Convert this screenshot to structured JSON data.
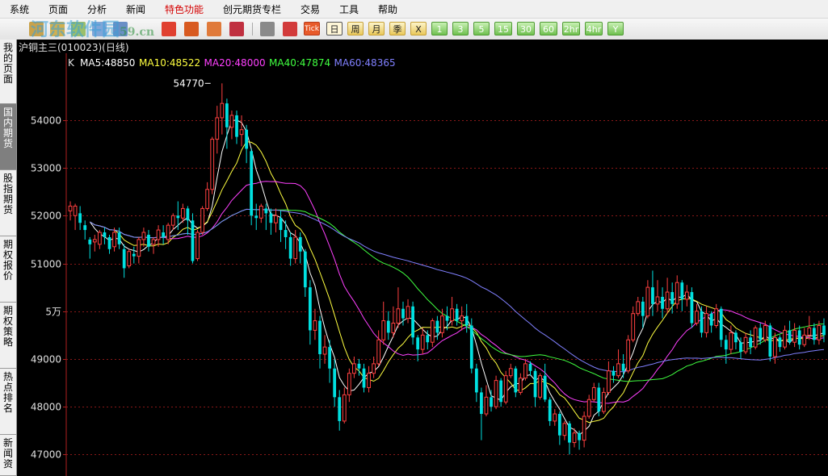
{
  "menu": {
    "items": [
      "系统",
      "页面",
      "分析",
      "新闻",
      "特色功能",
      "创元期货专栏",
      "交易",
      "工具",
      "帮助"
    ],
    "highlight_color": "#d40000"
  },
  "toolbar": {
    "period_buttons": [
      "日",
      "周",
      "月",
      "季",
      "X",
      "1",
      "3",
      "5",
      "15",
      "30",
      "60",
      "2hr",
      "4hr",
      "Y"
    ],
    "tick_label": "Tick",
    "active": "日"
  },
  "watermark": {
    "text": "河东软件园",
    "suffix": "59.cn"
  },
  "sidebar": {
    "tabs": [
      "我的页面",
      "国内期货",
      "股指期货",
      "期权报价",
      "期权策略",
      "热点排名",
      "新闻资"
    ],
    "active": "国内期货"
  },
  "title": "沪铜主三(010023)(日线)",
  "indicators": {
    "k_label": "K",
    "items": [
      {
        "label": "MA5:48850",
        "color": "#ffffff"
      },
      {
        "label": "MA10:48522",
        "color": "#ffff40"
      },
      {
        "label": "MA20:48000",
        "color": "#ff40ff"
      },
      {
        "label": "MA40:47874",
        "color": "#40ff40"
      },
      {
        "label": "MA60:48365",
        "color": "#8080ff"
      }
    ]
  },
  "chart_data": {
    "type": "candlestick",
    "y_ticks": [
      {
        "value": 54000,
        "label": "54000"
      },
      {
        "value": 53000,
        "label": "53000"
      },
      {
        "value": 52000,
        "label": "52000"
      },
      {
        "value": 51000,
        "label": "51000"
      },
      {
        "value": 50000,
        "label": "5万"
      },
      {
        "value": 49000,
        "label": "49000"
      },
      {
        "value": 48000,
        "label": "48000"
      },
      {
        "value": 47000,
        "label": "47000"
      }
    ],
    "ylim": [
      46550,
      55400
    ],
    "grid": "horizontal dashed",
    "max_annotation": {
      "label": "54770",
      "value": 54770,
      "index": 29
    },
    "up_color": "#ff4040",
    "down_color": "#00e0e0",
    "candles": [
      [
        52100,
        52200,
        51900,
        52300
      ],
      [
        52000,
        52200,
        51700,
        52250
      ],
      [
        52050,
        51850,
        51700,
        52200
      ],
      [
        51800,
        51700,
        51500,
        51900
      ],
      [
        51500,
        51400,
        51100,
        51550
      ],
      [
        51450,
        51500,
        51250,
        51600
      ],
      [
        51400,
        51650,
        51300,
        51700
      ],
      [
        51650,
        51550,
        51400,
        51750
      ],
      [
        51550,
        51300,
        51200,
        51600
      ],
      [
        51350,
        51650,
        51250,
        51750
      ],
      [
        51650,
        51400,
        51300,
        51750
      ],
      [
        51300,
        50900,
        50700,
        51400
      ],
      [
        50950,
        51250,
        50900,
        51300
      ],
      [
        51200,
        51150,
        51000,
        51350
      ],
      [
        51150,
        51500,
        51000,
        51550
      ],
      [
        51500,
        51650,
        51350,
        51750
      ],
      [
        51600,
        51350,
        51250,
        51700
      ],
      [
        51400,
        51500,
        51200,
        51550
      ],
      [
        51500,
        51700,
        51350,
        51800
      ],
      [
        51650,
        51550,
        51400,
        51800
      ],
      [
        51500,
        51800,
        51400,
        51850
      ],
      [
        51800,
        52000,
        51700,
        52050
      ],
      [
        52000,
        51950,
        51700,
        52300
      ],
      [
        51950,
        52150,
        51850,
        52250
      ],
      [
        52150,
        51900,
        51600,
        52200
      ],
      [
        51900,
        51050,
        51000,
        52050
      ],
      [
        51100,
        51650,
        51050,
        51700
      ],
      [
        51650,
        52150,
        51600,
        52200
      ],
      [
        52150,
        52550,
        52100,
        52700
      ],
      [
        52550,
        53600,
        52450,
        53650
      ],
      [
        53600,
        54050,
        53300,
        54300
      ],
      [
        54050,
        54350,
        53700,
        54770
      ],
      [
        54350,
        53850,
        53400,
        54450
      ],
      [
        53850,
        54100,
        53600,
        54200
      ],
      [
        54100,
        53650,
        53500,
        54200
      ],
      [
        53700,
        53800,
        53450,
        54100
      ],
      [
        53800,
        53400,
        53100,
        53900
      ],
      [
        53350,
        52000,
        51800,
        53400
      ],
      [
        52000,
        51950,
        51700,
        52250
      ],
      [
        51950,
        52200,
        51850,
        52250
      ],
      [
        52150,
        52050,
        51700,
        52250
      ],
      [
        52050,
        51850,
        51600,
        52150
      ],
      [
        51850,
        52000,
        51650,
        52150
      ],
      [
        51950,
        51700,
        51450,
        52100
      ],
      [
        51700,
        51550,
        51300,
        51900
      ],
      [
        51550,
        51100,
        50950,
        51650
      ],
      [
        51100,
        51550,
        51000,
        51700
      ],
      [
        51550,
        51250,
        51000,
        51650
      ],
      [
        51250,
        50500,
        50300,
        51300
      ],
      [
        50500,
        49600,
        49300,
        50650
      ],
      [
        49600,
        49800,
        49400,
        50050
      ],
      [
        49800,
        49100,
        48800,
        49900
      ],
      [
        49100,
        49250,
        48900,
        49500
      ],
      [
        49250,
        48800,
        48500,
        49400
      ],
      [
        48800,
        48200,
        48000,
        49000
      ],
      [
        48200,
        47700,
        47500,
        48350
      ],
      [
        47700,
        48250,
        47650,
        48400
      ],
      [
        48250,
        48700,
        48100,
        48800
      ],
      [
        48700,
        48900,
        48600,
        49050
      ],
      [
        48900,
        48800,
        48650,
        49000
      ],
      [
        48800,
        48400,
        48300,
        48900
      ],
      [
        48400,
        48700,
        48300,
        48850
      ],
      [
        48700,
        48900,
        48600,
        49050
      ],
      [
        48900,
        49400,
        48850,
        49600
      ],
      [
        49400,
        49800,
        49300,
        50200
      ],
      [
        49800,
        49550,
        49400,
        50000
      ],
      [
        49550,
        49750,
        49450,
        50100
      ],
      [
        49750,
        50050,
        49650,
        50500
      ],
      [
        50050,
        49850,
        49700,
        50200
      ],
      [
        49850,
        50100,
        49750,
        50250
      ],
      [
        50100,
        49450,
        49300,
        50200
      ],
      [
        49450,
        49200,
        48950,
        49500
      ],
      [
        49200,
        49500,
        49100,
        49650
      ],
      [
        49500,
        49350,
        49200,
        49600
      ],
      [
        49350,
        49800,
        49250,
        49850
      ],
      [
        49800,
        49550,
        49400,
        49900
      ],
      [
        49550,
        49900,
        49450,
        50050
      ],
      [
        49900,
        49800,
        49600,
        50100
      ],
      [
        49800,
        50050,
        49700,
        50300
      ],
      [
        50050,
        49800,
        49700,
        50150
      ],
      [
        49800,
        49900,
        49600,
        50100
      ],
      [
        49900,
        49700,
        49550,
        50150
      ],
      [
        49700,
        48800,
        48700,
        49850
      ],
      [
        48800,
        48300,
        48100,
        48900
      ],
      [
        48300,
        47850,
        47300,
        48400
      ],
      [
        47850,
        48200,
        47800,
        48450
      ],
      [
        48200,
        48000,
        47900,
        48350
      ],
      [
        48000,
        48550,
        47950,
        48650
      ],
      [
        48550,
        48100,
        48000,
        48600
      ],
      [
        48100,
        48650,
        48050,
        48750
      ],
      [
        48650,
        48800,
        48600,
        48900
      ],
      [
        48800,
        48300,
        48200,
        48850
      ],
      [
        48300,
        48600,
        48250,
        48700
      ],
      [
        48600,
        48900,
        48550,
        49000
      ],
      [
        48900,
        48750,
        48650,
        48950
      ],
      [
        48750,
        48200,
        48000,
        48800
      ],
      [
        48200,
        48650,
        48150,
        48700
      ],
      [
        48650,
        48150,
        48100,
        48900
      ],
      [
        48150,
        47700,
        47600,
        48200
      ],
      [
        47700,
        47850,
        47600,
        47950
      ],
      [
        47850,
        47400,
        47200,
        47900
      ],
      [
        47400,
        47650,
        47300,
        47700
      ],
      [
        47650,
        47250,
        47000,
        47700
      ],
      [
        47250,
        47450,
        47150,
        47550
      ],
      [
        47450,
        47300,
        47100,
        47500
      ],
      [
        47300,
        47800,
        47150,
        47900
      ],
      [
        47800,
        48150,
        47750,
        48250
      ],
      [
        48150,
        48400,
        48100,
        48500
      ],
      [
        48400,
        47900,
        47800,
        48500
      ],
      [
        47900,
        48300,
        47850,
        48400
      ],
      [
        48300,
        48750,
        48250,
        48950
      ],
      [
        48750,
        48650,
        48500,
        48850
      ],
      [
        48650,
        48900,
        48600,
        49200
      ],
      [
        48900,
        48750,
        48600,
        49100
      ],
      [
        48750,
        49400,
        48700,
        49500
      ],
      [
        49400,
        49950,
        49350,
        50100
      ],
      [
        49950,
        50200,
        49900,
        50300
      ],
      [
        50200,
        49900,
        49650,
        50300
      ],
      [
        49900,
        50500,
        49850,
        50650
      ],
      [
        50500,
        50150,
        49900,
        50850
      ],
      [
        50150,
        50300,
        50000,
        50650
      ],
      [
        50300,
        50050,
        49850,
        50500
      ],
      [
        50050,
        50400,
        49950,
        50700
      ],
      [
        50400,
        50150,
        49950,
        50600
      ],
      [
        50150,
        50600,
        50050,
        50750
      ],
      [
        50600,
        50250,
        50000,
        50650
      ],
      [
        50250,
        50400,
        50100,
        50550
      ],
      [
        50400,
        49750,
        49650,
        50500
      ],
      [
        49750,
        50000,
        49700,
        50150
      ],
      [
        50000,
        49550,
        49450,
        50100
      ],
      [
        49550,
        49950,
        49450,
        50100
      ],
      [
        49950,
        49700,
        49550,
        50000
      ],
      [
        49700,
        50050,
        49650,
        50150
      ],
      [
        50050,
        49400,
        49250,
        50100
      ],
      [
        49400,
        49200,
        48900,
        49500
      ],
      [
        49200,
        49550,
        49100,
        49700
      ],
      [
        49550,
        49350,
        49200,
        49600
      ],
      [
        49350,
        49150,
        49000,
        49450
      ],
      [
        49150,
        49450,
        49100,
        49550
      ],
      [
        49450,
        49250,
        49100,
        49600
      ],
      [
        49250,
        49650,
        49200,
        49700
      ],
      [
        49650,
        49400,
        49300,
        49750
      ],
      [
        49400,
        49700,
        49350,
        49800
      ],
      [
        49700,
        49050,
        48950,
        49750
      ],
      [
        49050,
        49450,
        48900,
        49550
      ],
      [
        49450,
        49250,
        49150,
        49500
      ],
      [
        49250,
        49600,
        49200,
        49700
      ],
      [
        49600,
        49350,
        49300,
        49800
      ],
      [
        49350,
        49600,
        49250,
        49750
      ],
      [
        49600,
        49300,
        49200,
        49700
      ],
      [
        49300,
        49500,
        49250,
        49650
      ],
      [
        49500,
        49650,
        49400,
        49900
      ],
      [
        49650,
        49400,
        49300,
        49750
      ],
      [
        49400,
        49700,
        49300,
        49800
      ],
      [
        49700,
        49500,
        49350,
        49850
      ]
    ]
  }
}
